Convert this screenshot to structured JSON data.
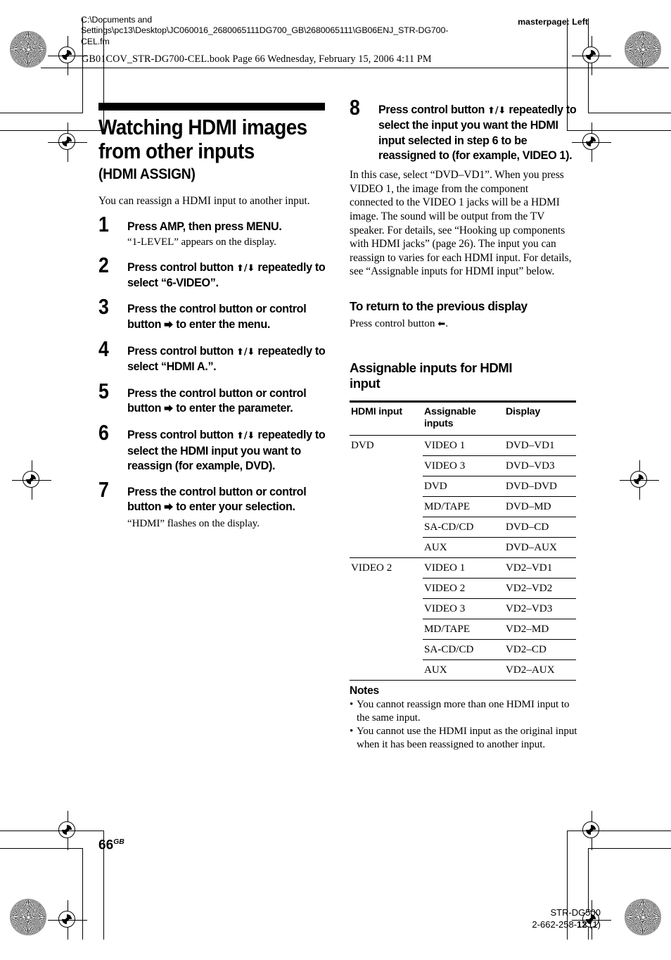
{
  "header": {
    "path_line1": "C:\\Documents and",
    "path_line2": "Settings\\pc13\\Desktop\\JC060016_2680065111DG700_GB\\2680065111\\GB06ENJ_STR-DG700-",
    "path_line3": "CEL.fm",
    "masterpage": "masterpage: Left",
    "book_line": "GB01COV_STR-DG700-CEL.book  Page 66  Wednesday, February 15, 2006  4:11 PM"
  },
  "left_column": {
    "title_line1": "Watching HDMI images",
    "title_line2": "from other inputs",
    "title_sub": "(HDMI ASSIGN)",
    "lead": "You can reassign a HDMI input to another input.",
    "steps": [
      {
        "number": "1",
        "text": "Press AMP, then press MENU.",
        "note": "“1-LEVEL” appears on the display."
      },
      {
        "number": "2",
        "text_before": "Press control button ",
        "arrows": "⬆/⬇",
        "text_after": " repeatedly to select “6-VIDEO”.",
        "note": ""
      },
      {
        "number": "3",
        "text_before": "Press the control button or control button ",
        "arrows": "⮕",
        "text_after": " to enter the menu.",
        "note": ""
      },
      {
        "number": "4",
        "text_before": "Press control button ",
        "arrows": "⬆/⬇",
        "text_after": " repeatedly to select “HDMI A.”.",
        "note": ""
      },
      {
        "number": "5",
        "text_before": "Press the control button or control button ",
        "arrows": "⮕",
        "text_after": " to enter the parameter.",
        "note": ""
      },
      {
        "number": "6",
        "text_before": "Press control button ",
        "arrows": "⬆/⬇",
        "text_after": " repeatedly to select the HDMI input you want to reassign (for example, DVD).",
        "note": ""
      },
      {
        "number": "7",
        "text_before": "Press the control button or control button ",
        "arrows": "⮕",
        "text_after": " to enter your selection.",
        "note": "“HDMI” flashes on the display."
      }
    ]
  },
  "right_column": {
    "step8": {
      "number": "8",
      "text_before": "Press control button ",
      "arrows": "⬆/⬇",
      "text_after": " repeatedly to select the input you want the HDMI input selected in step 6 to be reassigned to (for example, VIDEO 1)."
    },
    "step8_body": "In this case, select “DVD–VD1”. When you press VIDEO 1, the image from the component connected to the VIDEO 1 jacks will be a HDMI image. The sound will be output from the TV speaker. For details, see “Hooking up components with HDMI jacks” (page 26). The input you can reassign to varies for each HDMI input. For details, see “Assignable inputs for HDMI input” below.",
    "return_heading": "To return to the previous display",
    "return_text_before": "Press control button ",
    "return_arrow": "⬅",
    "return_text_after": ".",
    "table_heading_line1": "Assignable inputs for HDMI",
    "table_heading_line2": "input",
    "table": {
      "headers": [
        "HDMI input",
        "Assignable inputs",
        "Display"
      ],
      "rows": [
        {
          "hdmi_input": "DVD",
          "assignable": "VIDEO 1",
          "display": "DVD–VD1",
          "group_start": true
        },
        {
          "hdmi_input": "",
          "assignable": "VIDEO 3",
          "display": "DVD–VD3",
          "group_start": false
        },
        {
          "hdmi_input": "",
          "assignable": "DVD",
          "display": "DVD–DVD",
          "group_start": false
        },
        {
          "hdmi_input": "",
          "assignable": "MD/TAPE",
          "display": "DVD–MD",
          "group_start": false
        },
        {
          "hdmi_input": "",
          "assignable": "SA-CD/CD",
          "display": "DVD–CD",
          "group_start": false
        },
        {
          "hdmi_input": "",
          "assignable": "AUX",
          "display": "DVD–AUX",
          "group_start": false
        },
        {
          "hdmi_input": "VIDEO 2",
          "assignable": "VIDEO 1",
          "display": "VD2–VD1",
          "group_start": true
        },
        {
          "hdmi_input": "",
          "assignable": "VIDEO 2",
          "display": "VD2–VD2",
          "group_start": false
        },
        {
          "hdmi_input": "",
          "assignable": "VIDEO 3",
          "display": "VD2–VD3",
          "group_start": false
        },
        {
          "hdmi_input": "",
          "assignable": "MD/TAPE",
          "display": "VD2–MD",
          "group_start": false
        },
        {
          "hdmi_input": "",
          "assignable": "SA-CD/CD",
          "display": "VD2–CD",
          "group_start": false
        },
        {
          "hdmi_input": "",
          "assignable": "AUX",
          "display": "VD2–AUX",
          "group_start": false
        }
      ]
    },
    "notes_heading": "Notes",
    "notes": [
      "You cannot reassign more than one HDMI input to the same input.",
      "You cannot use the HDMI input as the original input when it has been reassigned to another input."
    ]
  },
  "footer": {
    "page_number": "66",
    "page_suffix": "GB",
    "model": "STR-DG500",
    "doc_number_prefix": "2-662-258-",
    "doc_number_bold": "12",
    "doc_number_suffix": " (1)"
  }
}
